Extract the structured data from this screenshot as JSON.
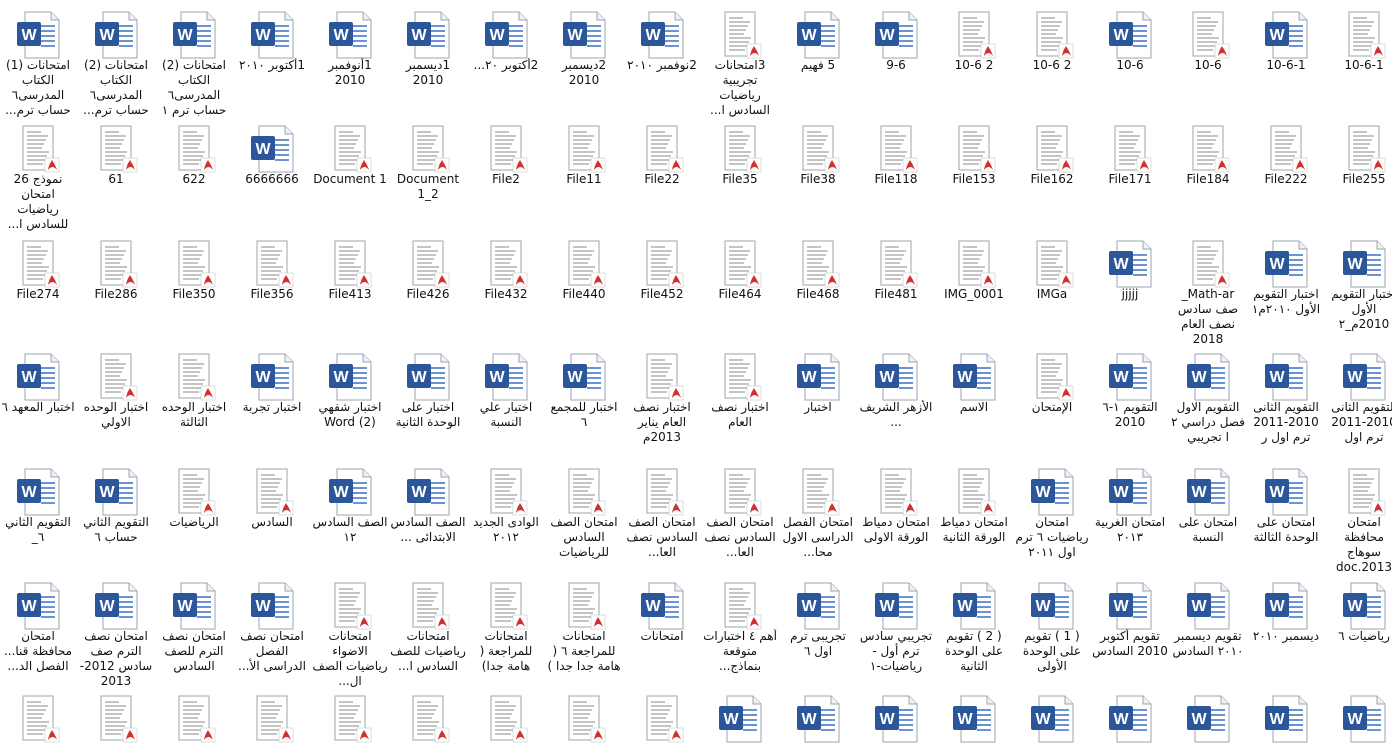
{
  "window": {
    "title": ""
  },
  "icons": {
    "word": "word-document-icon",
    "pdf": "pdf-document-icon"
  },
  "colors": {
    "word_blue": "#2b579a",
    "word_blue_light": "#3c70c2",
    "pdf_red": "#d32f2f",
    "page_border": "#9aa4b1",
    "label_text": "#111111"
  },
  "rows": [
    [
      {
        "label": "امتحانات (1) الكتاب المدرسى٦ حساب ترم...",
        "type": "word"
      },
      {
        "label": "امتحانات (2) الكتاب المدرسى٦ حساب ترم...",
        "type": "word"
      },
      {
        "label": "امتحانات (2) الكتاب المدرسى٦ حساب ترم ١",
        "type": "word"
      },
      {
        "label": "1أكتوبر ٢٠١٠",
        "type": "word"
      },
      {
        "label": "1أنوفمبر 2010",
        "type": "word"
      },
      {
        "label": "1ديسمبر 2010",
        "type": "word"
      },
      {
        "label": "2أكتوبر ٢٠...",
        "type": "word"
      },
      {
        "label": "2ديسمبر 2010",
        "type": "word"
      },
      {
        "label": "2نوفمبر ٢٠١٠",
        "type": "word"
      },
      {
        "label": "3امتحانات تجريبية رياضيات السادس ا...",
        "type": "pdf"
      },
      {
        "label": "5 فهيم",
        "type": "word"
      },
      {
        "label": "9-6",
        "type": "word"
      },
      {
        "label": "10-6 2",
        "type": "pdf"
      },
      {
        "label": "10-6 2",
        "type": "pdf"
      },
      {
        "label": "10-6",
        "type": "word"
      },
      {
        "label": "10-6",
        "type": "pdf"
      },
      {
        "label": "10-6-1",
        "type": "word"
      },
      {
        "label": "10-6-1",
        "type": "pdf"
      }
    ],
    [
      {
        "label": "نموذج 26 امتحان رياضيات للسادس ا...",
        "type": "pdf"
      },
      {
        "label": "61",
        "type": "pdf"
      },
      {
        "label": "622",
        "type": "pdf"
      },
      {
        "label": "6666666",
        "type": "word"
      },
      {
        "label": "Document 1",
        "type": "pdf"
      },
      {
        "label": "Document 1_2",
        "type": "pdf"
      },
      {
        "label": "File2",
        "type": "pdf"
      },
      {
        "label": "File11",
        "type": "pdf"
      },
      {
        "label": "File22",
        "type": "pdf"
      },
      {
        "label": "File35",
        "type": "pdf"
      },
      {
        "label": "File38",
        "type": "pdf"
      },
      {
        "label": "File118",
        "type": "pdf"
      },
      {
        "label": "File153",
        "type": "pdf"
      },
      {
        "label": "File162",
        "type": "pdf"
      },
      {
        "label": "File171",
        "type": "pdf"
      },
      {
        "label": "File184",
        "type": "pdf"
      },
      {
        "label": "File222",
        "type": "pdf"
      },
      {
        "label": "File255",
        "type": "pdf"
      }
    ],
    [
      {
        "label": "File274",
        "type": "pdf"
      },
      {
        "label": "File286",
        "type": "pdf"
      },
      {
        "label": "File350",
        "type": "pdf"
      },
      {
        "label": "File356",
        "type": "pdf"
      },
      {
        "label": "File413",
        "type": "pdf"
      },
      {
        "label": "File426",
        "type": "pdf"
      },
      {
        "label": "File432",
        "type": "pdf"
      },
      {
        "label": "File440",
        "type": "pdf"
      },
      {
        "label": "File452",
        "type": "pdf"
      },
      {
        "label": "File464",
        "type": "pdf"
      },
      {
        "label": "File468",
        "type": "pdf"
      },
      {
        "label": "File481",
        "type": "pdf"
      },
      {
        "label": "IMG_0001",
        "type": "pdf"
      },
      {
        "label": "IMGa",
        "type": "pdf"
      },
      {
        "label": "jjjjj",
        "type": "word"
      },
      {
        "label": "Math-ar_ صف سادس نصف العام 2018",
        "type": "pdf"
      },
      {
        "label": "اختبار التقويم الأول ٢٠١٠م١",
        "type": "word"
      },
      {
        "label": "اختبار التقويم الأول 2010م_٢",
        "type": "word"
      }
    ],
    [
      {
        "label": "اختبار المعهد ٦",
        "type": "word"
      },
      {
        "label": "اختبار الوحده الاولي",
        "type": "pdf"
      },
      {
        "label": "اختبار الوحده الثالثة",
        "type": "pdf"
      },
      {
        "label": "اختبار تجربة",
        "type": "word"
      },
      {
        "label": "اختبار شفهي Word (2)",
        "type": "word"
      },
      {
        "label": "اختبار على الوحدة الثانية",
        "type": "word"
      },
      {
        "label": "اختبار علي النسبة",
        "type": "word"
      },
      {
        "label": "اختبار للمجمع ٦",
        "type": "word"
      },
      {
        "label": "اختبار نصف العام يناير 2013م",
        "type": "pdf"
      },
      {
        "label": "اختبار نصف العام",
        "type": "pdf"
      },
      {
        "label": "اختبار",
        "type": "word"
      },
      {
        "label": "الأزهر الشريف ...",
        "type": "word"
      },
      {
        "label": "الاسم",
        "type": "word"
      },
      {
        "label": "الإمتحان",
        "type": "pdf"
      },
      {
        "label": "التقويم ١-٦ 2010",
        "type": "word"
      },
      {
        "label": "التقويم الاول فصل دراسي ٢ ا تجريبي",
        "type": "word"
      },
      {
        "label": "التقويم الثانى 2010-2011 ترم اول ر",
        "type": "word"
      },
      {
        "label": "التقويم الثانى 2010-2011 ترم اول",
        "type": "word"
      }
    ],
    [
      {
        "label": "التقويم الثاني ٦_",
        "type": "word"
      },
      {
        "label": "التقويم الثاني حساب ٦",
        "type": "word"
      },
      {
        "label": "الرياضيات",
        "type": "pdf"
      },
      {
        "label": "السادس",
        "type": "pdf"
      },
      {
        "label": "الصف السادس ١٢",
        "type": "word"
      },
      {
        "label": "الصف السادس الابتدائى ...",
        "type": "word"
      },
      {
        "label": "الوادى الجديد ٢٠١٢",
        "type": "pdf"
      },
      {
        "label": "امتحان الصف السادس للرياضيات",
        "type": "pdf"
      },
      {
        "label": "امتحان الصف السادس نصف العا...",
        "type": "pdf"
      },
      {
        "label": "امتحان الصف السادس نصف العا...",
        "type": "pdf"
      },
      {
        "label": "امتحان الفصل الدراسى الاول محا...",
        "type": "pdf"
      },
      {
        "label": "امتحان دمياط الورقة الاولى",
        "type": "pdf"
      },
      {
        "label": "امتحان دمياط الورقة الثانية",
        "type": "pdf"
      },
      {
        "label": "امتحان رياضيات ٦ ترم اول ٢٠١١",
        "type": "word"
      },
      {
        "label": "امتحان الغربية ٢٠١٣",
        "type": "word"
      },
      {
        "label": "امتحان على النسبة",
        "type": "word"
      },
      {
        "label": "امتحان على الوحدة الثالثة",
        "type": "word"
      },
      {
        "label": "امتحان محافظة سوهاج 2013.doc",
        "type": "pdf"
      }
    ],
    [
      {
        "label": "امتحان محافظة قنا... الفصل الد...",
        "type": "word"
      },
      {
        "label": "امتحان نصف الترم صف سادس 2012-2013",
        "type": "word"
      },
      {
        "label": "امتحان نصف الترم للصف السادس",
        "type": "word"
      },
      {
        "label": "امتحان نصف الفصل الدراسى الأ...",
        "type": "word"
      },
      {
        "label": "امتحانات الاضواء رياضيات الصف ال...",
        "type": "pdf"
      },
      {
        "label": "امتحانات رياضيات للصف السادس ا...",
        "type": "pdf"
      },
      {
        "label": "امتحانات للمراجعة ( هامة جدا)",
        "type": "pdf"
      },
      {
        "label": "امتحانات للمراجعة ٦ ( هامة جدا جدا )",
        "type": "pdf"
      },
      {
        "label": "امتحانات",
        "type": "word"
      },
      {
        "label": "أهم ٤ اختبارات متوقعة بنماذج...",
        "type": "pdf"
      },
      {
        "label": "تجريبى ترم اول ٦",
        "type": "word"
      },
      {
        "label": "تجريبي سادس ترم أول - رياضيات-١",
        "type": "word"
      },
      {
        "label": "( 2 ) تقويم على الوحدة الثانية",
        "type": "word"
      },
      {
        "label": "( 1 ) تقويم على الوحدة الأولى",
        "type": "word"
      },
      {
        "label": "تقويم أكتوبر 2010 السادس",
        "type": "word"
      },
      {
        "label": "تقويم ديسمبر ٢٠١٠ السادس",
        "type": "word"
      },
      {
        "label": "ديسمبر ٢٠١٠",
        "type": "word"
      },
      {
        "label": "رياضيات ٦",
        "type": "word"
      }
    ],
    [
      {
        "label": "",
        "type": "pdf"
      },
      {
        "label": "",
        "type": "pdf"
      },
      {
        "label": "",
        "type": "pdf"
      },
      {
        "label": "",
        "type": "pdf"
      },
      {
        "label": "",
        "type": "pdf"
      },
      {
        "label": "",
        "type": "pdf"
      },
      {
        "label": "",
        "type": "pdf"
      },
      {
        "label": "",
        "type": "pdf"
      },
      {
        "label": "",
        "type": "pdf"
      },
      {
        "label": "",
        "type": "word"
      },
      {
        "label": "",
        "type": "word"
      },
      {
        "label": "",
        "type": "word"
      },
      {
        "label": "",
        "type": "word"
      },
      {
        "label": "",
        "type": "word"
      },
      {
        "label": "",
        "type": "word"
      },
      {
        "label": "",
        "type": "word"
      },
      {
        "label": "",
        "type": "word"
      },
      {
        "label": "",
        "type": "word"
      }
    ]
  ]
}
